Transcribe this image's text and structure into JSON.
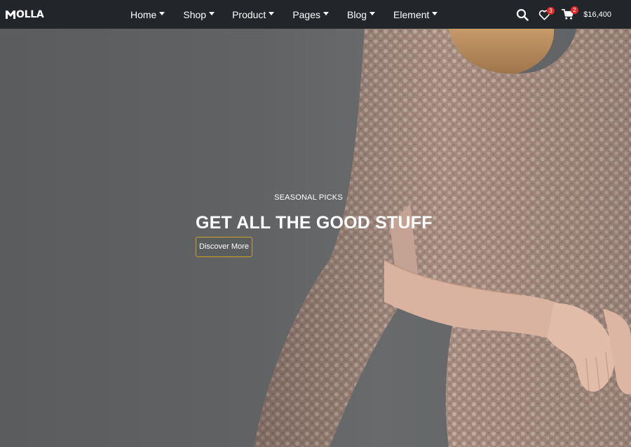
{
  "header": {
    "logo_text": "OLLA",
    "nav": [
      {
        "label": "Home"
      },
      {
        "label": "Shop"
      },
      {
        "label": "Product"
      },
      {
        "label": "Pages"
      },
      {
        "label": "Blog"
      },
      {
        "label": "Element"
      }
    ],
    "wishlist_count": "3",
    "cart_count": "2",
    "cart_total": "$16,400"
  },
  "hero": {
    "subtitle": "SEASONAL PICKS",
    "title": "GET ALL THE GOOD STUFF",
    "button_label": "Discover More"
  },
  "colors": {
    "header_bg": "#222529",
    "accent": "#c9a227",
    "badge": "#e02b27",
    "hero_bg": "#5e6163"
  },
  "icons": [
    "search-icon",
    "heart-icon",
    "cart-icon",
    "caret-down-icon"
  ]
}
